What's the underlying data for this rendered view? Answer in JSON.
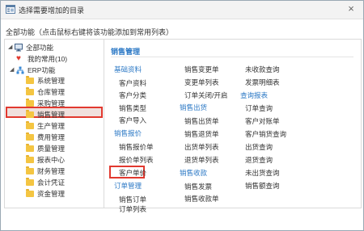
{
  "window": {
    "title": "选择需要增加的目录",
    "close_glyph": "×"
  },
  "subtitle": "全部功能（点击鼠标右键将该功能添加到常用列表）",
  "tree": {
    "root": "全部功能",
    "favorites": "我的常用(10)",
    "erp": "ERP功能",
    "folders": [
      "系统管理",
      "仓库管理",
      "采购管理",
      "销售管理",
      "生产管理",
      "费用管理",
      "质量管理",
      "报表中心",
      "财务管理",
      "会计凭证",
      "资金管理"
    ],
    "selected": "销售管理"
  },
  "content": {
    "title": "销售管理",
    "col1": {
      "basic": {
        "header": "基础资料",
        "items": [
          "客户资料",
          "客户分类",
          "销售类型",
          "客户导入"
        ]
      },
      "quote": {
        "header": "销售报价",
        "items": [
          "销售报价单",
          "报价单列表",
          "客户单价"
        ]
      },
      "order": {
        "header": "订单管理",
        "items": [
          "销售订单",
          "订单列表"
        ]
      }
    },
    "col2": {
      "change": {
        "items": [
          "销售变更单",
          "变更单列表",
          "订单关闭/开启"
        ]
      },
      "outbound": {
        "header": "销售出货",
        "items": [
          "销售出货单",
          "销售退货单",
          "出货单列表",
          "退货单列表"
        ]
      },
      "receipt": {
        "header": "销售收款",
        "items": [
          "销售发票",
          "销售收款单",
          "收款查询"
        ]
      }
    },
    "col3": {
      "misc": {
        "items": [
          "未收款查询",
          "发票明细表"
        ]
      },
      "report": {
        "header": "查询报表",
        "items": [
          "订单查询",
          "客户对账单",
          "客户销货查询",
          "出货查询",
          "退货查询",
          "未出货查询",
          "销售额查询"
        ]
      }
    }
  },
  "colors": {
    "accent": "#2b78c5",
    "highlight": "#e1392f",
    "folder": "#f4c542"
  }
}
